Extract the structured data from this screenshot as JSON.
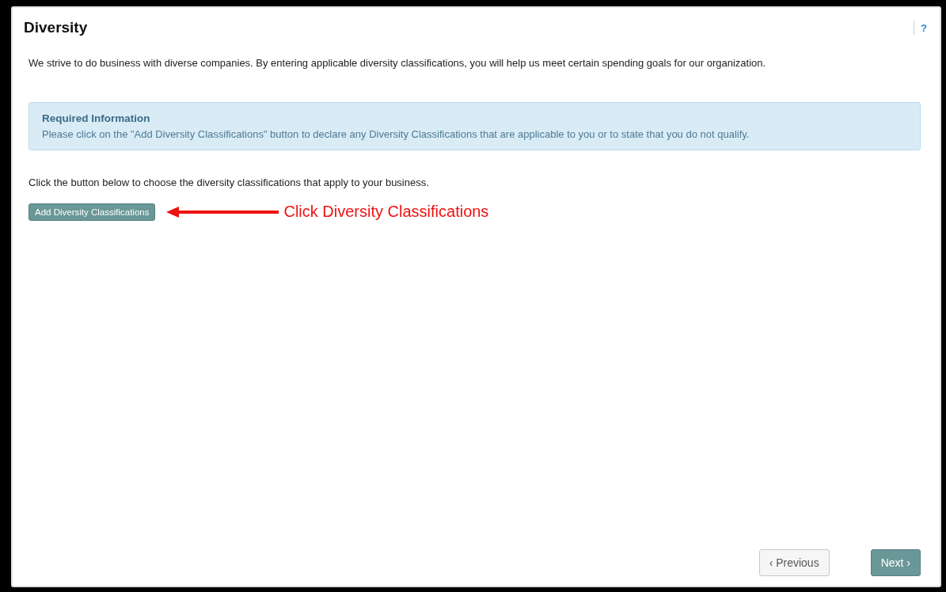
{
  "page": {
    "title": "Diversity",
    "help": "?"
  },
  "intro": "We strive to do business with diverse companies. By entering applicable diversity classifications, you will help us meet certain spending goals for our organization.",
  "notice": {
    "title": "Required Information",
    "text": "Please click on the \"Add Diversity Classifications\" button to declare any Diversity Classifications that are applicable to you or to state that you do not qualify."
  },
  "instruction": "Click the button below to choose the diversity classifications that apply to your business.",
  "action_button": "Add Diversity Classifications",
  "annotation": {
    "text": "Click Diversity Classifications"
  },
  "footer_buttons": [
    {
      "label": "‹ Previous",
      "kind": "secondary"
    },
    {
      "label": "Next ›",
      "kind": "primary"
    }
  ]
}
